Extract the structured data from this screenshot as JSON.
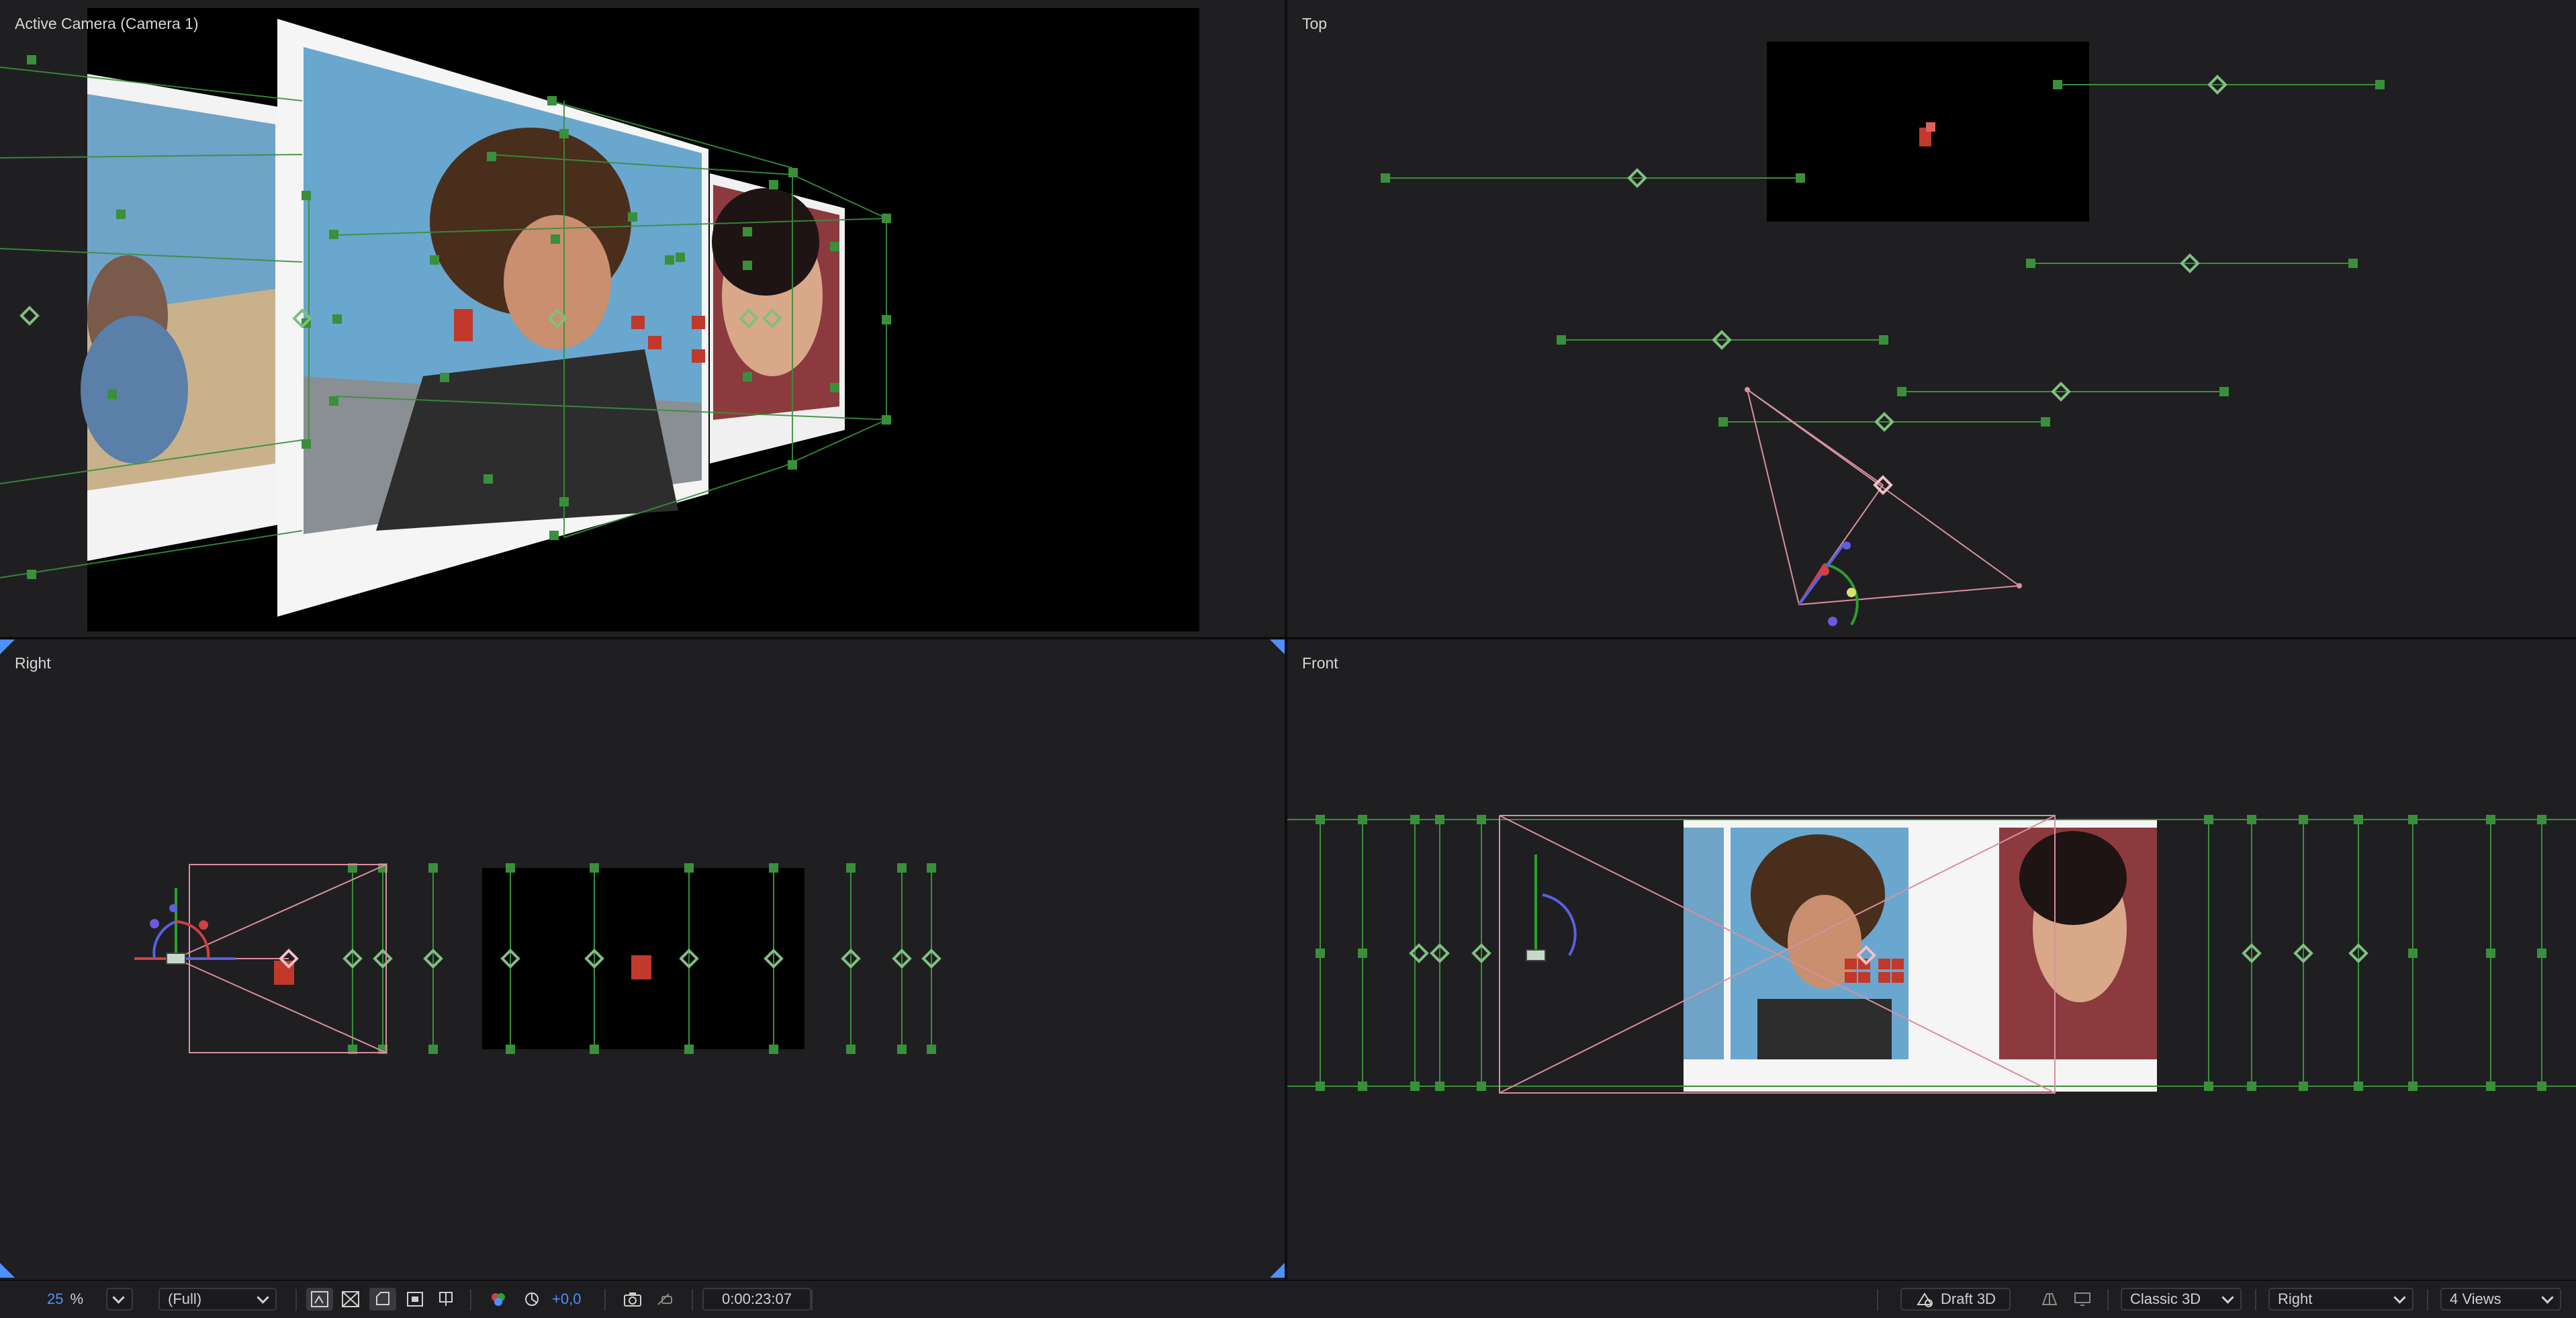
{
  "viewports": {
    "active_camera": {
      "title": "Active Camera (Camera 1)"
    },
    "top": {
      "title": "Top"
    },
    "right": {
      "title": "Right"
    },
    "front": {
      "title": "Front"
    }
  },
  "statusbar": {
    "zoom_value": "25",
    "zoom_unit": "%",
    "resolution": "(Full)",
    "exposure": "+0,0",
    "timecode": "0:00:23:07",
    "renderer_label": "Draft 3D",
    "renderer_mode": "Classic 3D",
    "view": "Right",
    "layout": "4 Views"
  },
  "colors": {
    "background": "#1f1f22",
    "handle_green": "#3a8f3a",
    "camera_pink": "#d98fa0",
    "accent_blue": "#4f8fff",
    "anchor_red": "#c0392b"
  }
}
